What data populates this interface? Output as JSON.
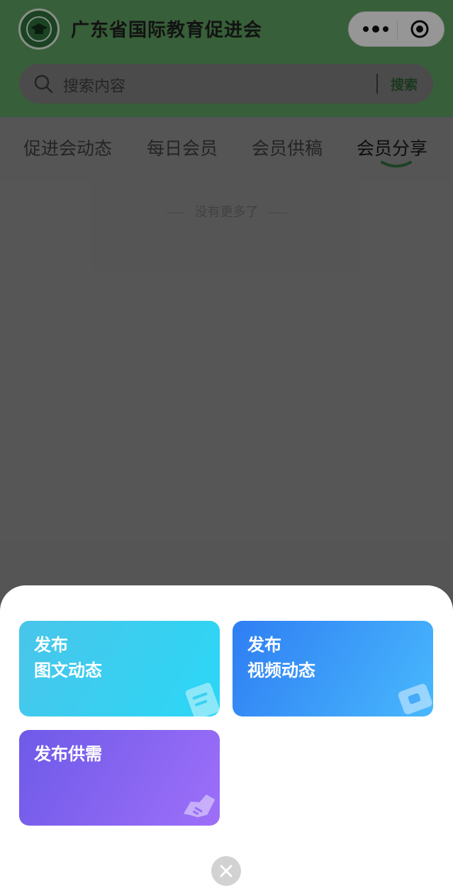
{
  "header": {
    "title": "广东省国际教育促进会",
    "logo_icon": "association-logo-icon",
    "capsule": {
      "more_icon": "more-dots-icon",
      "target_icon": "miniprogram-close-target-icon"
    }
  },
  "search": {
    "placeholder": "搜索内容",
    "button_label": "搜索",
    "icon": "search-icon"
  },
  "tabs": [
    {
      "label": "促进会动态",
      "active": false
    },
    {
      "label": "每日会员",
      "active": false
    },
    {
      "label": "会员供稿",
      "active": false
    },
    {
      "label": "会员分享",
      "active": true
    }
  ],
  "list_status": "没有更多了",
  "sheet": {
    "cards": [
      {
        "line1": "发布",
        "line2": "图文动态",
        "icon": "image-text-post-icon",
        "color": "#2bd7f6"
      },
      {
        "line1": "发布",
        "line2": "视频动态",
        "icon": "video-post-icon",
        "color": "#2f7ef3"
      },
      {
        "line1": "发布供需",
        "line2": "",
        "icon": "handshake-icon",
        "color": "#8b66f4"
      }
    ],
    "close_icon": "close-icon"
  },
  "colors": {
    "header_green": "#5a9a5c",
    "accent_green": "#2d5b33"
  }
}
